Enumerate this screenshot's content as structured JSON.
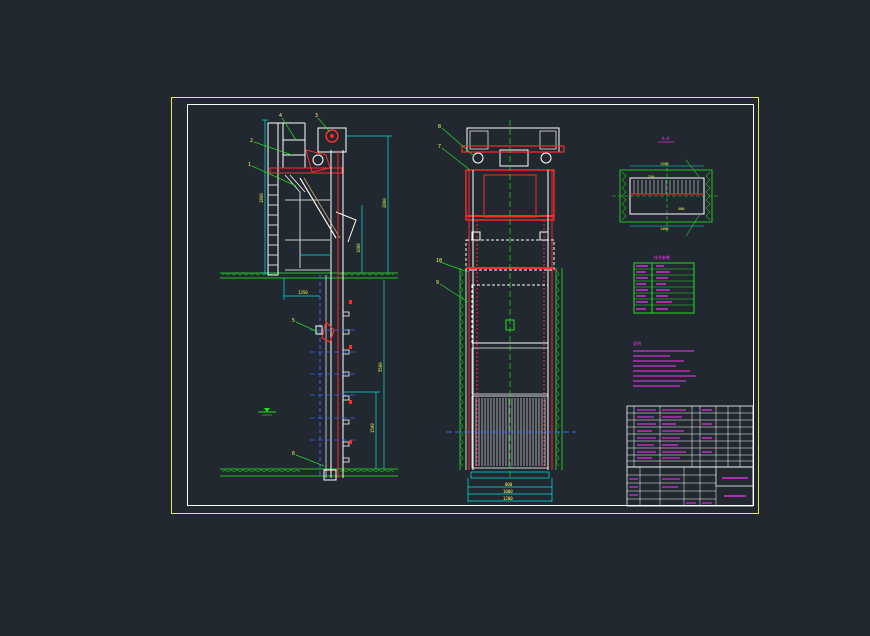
{
  "canvas": {
    "background": "#222830",
    "colors": {
      "sheet_border": "#e8e84a",
      "frame": "#ffffff",
      "structure": "#ffffff",
      "hidden_red": "#ff2a2a",
      "dimension": "#00e5e5",
      "leader": "#22e022",
      "ground": "#22c022",
      "label": "#ff33ff",
      "axis": "#3366ff"
    }
  },
  "drawing": {
    "note_title_glyph": "说明",
    "section_title_glyph": "A-A",
    "param_table_title": "技术参数",
    "title_block_name": "回转式格栅除污机"
  },
  "icons": {
    "elevation_marker": "water-level-icon"
  }
}
